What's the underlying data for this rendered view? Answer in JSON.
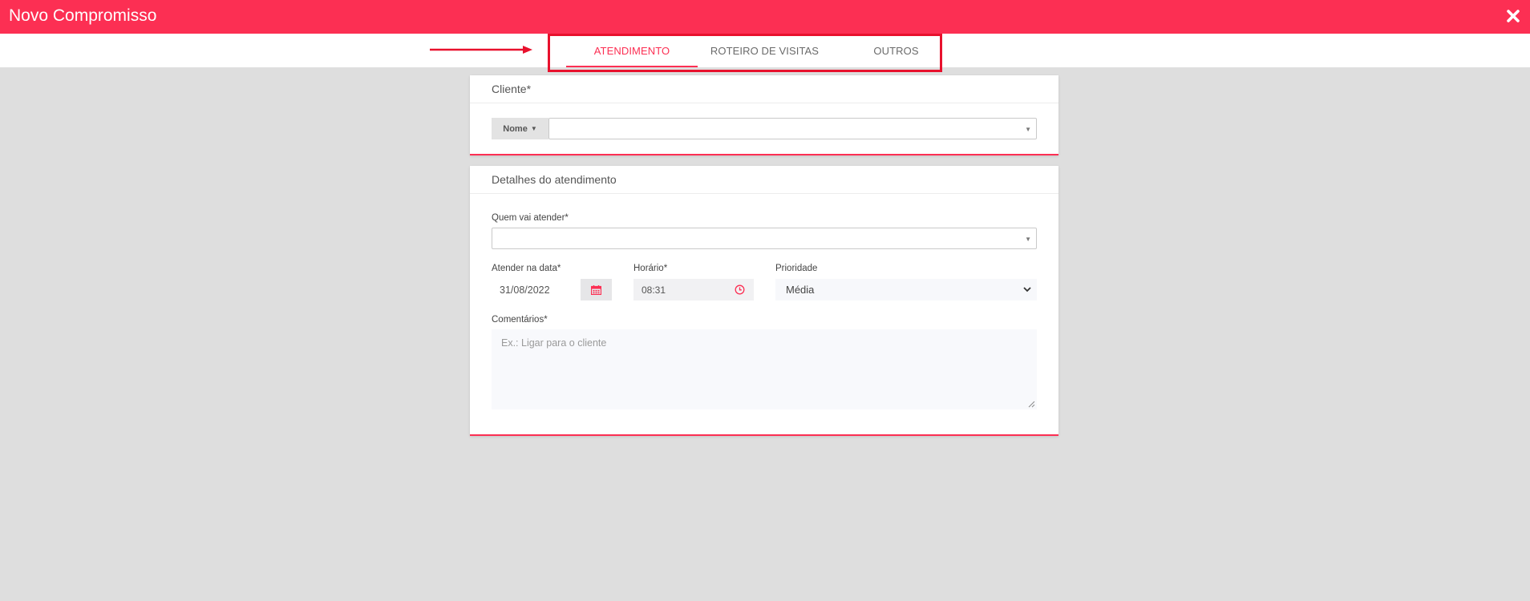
{
  "window": {
    "title": "Novo Compromisso",
    "close_icon": "close-icon"
  },
  "tabs": [
    {
      "label": "ATENDIMENTO",
      "active": true
    },
    {
      "label": "ROTEIRO DE VISITAS",
      "active": false
    },
    {
      "label": "OUTROS",
      "active": false
    }
  ],
  "cliente": {
    "header": "Cliente*",
    "search_type_label": "Nome",
    "search_type_icon": "caret-down-icon",
    "value": ""
  },
  "detalhes": {
    "header": "Detalhes do atendimento",
    "quem_label": "Quem vai atender*",
    "quem_value": "",
    "data_label": "Atender na data*",
    "data_value": "31/08/2022",
    "data_icon": "calendar-icon",
    "horario_label": "Horário*",
    "horario_value": "08:31",
    "horario_icon": "clock-icon",
    "prioridade_label": "Prioridade",
    "prioridade_value": "Média",
    "comentarios_label": "Comentários*",
    "comentarios_placeholder": "Ex.: Ligar para o cliente"
  },
  "colors": {
    "accent": "#fc2f53",
    "annotation": "#e8112d",
    "background": "#dedede"
  }
}
